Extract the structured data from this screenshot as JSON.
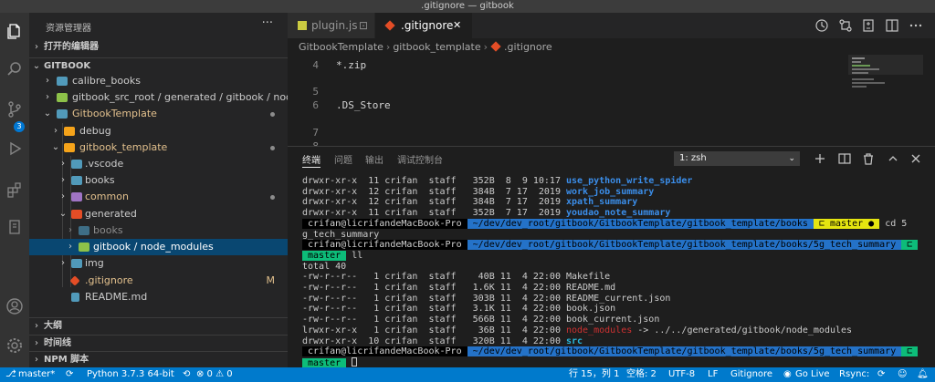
{
  "window": {
    "title": ".gitignore — gitbook"
  },
  "activity_bar": {
    "items": [
      "files-icon",
      "search-icon",
      "source-control-icon",
      "run-debug-icon",
      "extensions-icon",
      "notebook-icon",
      "account-icon",
      "settings-gear-icon"
    ],
    "scm_badge": "3"
  },
  "sidebar": {
    "title": "资源管理器",
    "more": "···",
    "open_editors": "打开的编辑器",
    "root": "GITBOOK",
    "tree": [
      {
        "label": "calibre_books"
      },
      {
        "label": "gitbook_src_root / generated / gitbook / node_..."
      },
      {
        "label": "GitbookTemplate"
      },
      {
        "label": "debug"
      },
      {
        "label": "gitbook_template"
      },
      {
        "label": ".vscode"
      },
      {
        "label": "books"
      },
      {
        "label": "common"
      },
      {
        "label": "generated"
      },
      {
        "label": "books"
      },
      {
        "label": "gitbook / node_modules"
      },
      {
        "label": "img"
      },
      {
        "label": ".gitignore",
        "badge": "M"
      },
      {
        "label": "README.md"
      }
    ],
    "outline": "大纲",
    "timeline": "时间线",
    "npm": "NPM 脚本"
  },
  "editor": {
    "tabs": [
      {
        "label": "plugin.js",
        "close": "⊡"
      },
      {
        "label": ".gitignore",
        "close": "✕"
      }
    ],
    "breadcrumb": [
      "GitbookTemplate",
      "gitbook_template",
      ".gitignore"
    ],
    "lines": [
      {
        "n": "4",
        "text": "*.zip"
      },
      {
        "n": "5",
        "text": ""
      },
      {
        "n": "6",
        "text": ".DS_Store"
      },
      {
        "n": "7",
        "text": ""
      },
      {
        "n": "8",
        "text": ""
      }
    ]
  },
  "panel": {
    "tabs": [
      "终端",
      "问题",
      "输出",
      "调试控制台"
    ],
    "terminal_select": "1: zsh",
    "terminal_lines": {
      "l1": {
        "perm": "drwxr-xr-x  11 crifan  staff   352B  8  9 10:17 ",
        "name": "use_python_write_spider"
      },
      "l2": {
        "perm": "drwxr-xr-x  12 crifan  staff   384B  7 17  2019 ",
        "name": "work_job_summary"
      },
      "l3": {
        "perm": "drwxr-xr-x  12 crifan  staff   384B  7 17  2019 ",
        "name": "xpath_summary"
      },
      "l4": {
        "perm": "drwxr-xr-x  11 crifan  staff   352B  7 17  2019 ",
        "name": "youdao_note_summary"
      },
      "p1": {
        "host": " crifan@licrifandeMacBook-Pro ",
        "path": " ~/dev/dev_root/gitbook/GitbookTemplate/gitbook_template/books ",
        "branch": " ⊏ master ● ",
        "cmd": " cd 5"
      },
      "p1_wrap": "g_tech_summary",
      "p2": {
        "host": " crifan@licrifandeMacBook-Pro ",
        "path": " ~/dev/dev_root/gitbook/GitbookTemplate/gitbook_template/books/5g_tech_summary ",
        "branch": " ⊏ ",
        "branch2": " master ",
        "cmd": " ll"
      },
      "total": "total 40",
      "files": [
        {
          "text": "-rw-r--r--   1 crifan  staff    40B 11  4 22:00 Makefile"
        },
        {
          "text": "-rw-r--r--   1 crifan  staff   1.6K 11  4 22:00 README.md"
        },
        {
          "text": "-rw-r--r--   1 crifan  staff   303B 11  4 22:00 README_current.json"
        },
        {
          "text": "-rw-r--r--   1 crifan  staff   3.1K 11  4 22:00 book.json"
        },
        {
          "text": "-rw-r--r--   1 crifan  staff   566B 11  4 22:00 book_current.json"
        }
      ],
      "link": {
        "perm": "lrwxr-xr-x   1 crifan  staff    36B 11  4 22:00 ",
        "name": "node_modules",
        "target": " -> ../../generated/gitbook/node_modules"
      },
      "src": {
        "perm": "drwxr-xr-x  10 crifan  staff   320B 11  4 22:00 ",
        "name": "src"
      },
      "p3": {
        "host": " crifan@licrifandeMacBook-Pro ",
        "path": " ~/dev/dev_root/gitbook/GitbookTemplate/gitbook_template/books/5g_tech_summary ",
        "branch": " ⊏ "
      },
      "p3_branch": " master "
    }
  },
  "status_bar": {
    "branch": "master*",
    "python": "Python 3.7.3 64-bit",
    "problems": "⊗ 0  ⚠ 0",
    "position": "行 15，列 1",
    "spaces": "空格: 2",
    "encoding": "UTF-8",
    "eol": "LF",
    "language": "Gitignore",
    "golive": "Go Live",
    "rsync": "Rsync:"
  },
  "colors": {
    "folder_blue": "#519aba",
    "folder_orange": "#f5a31a",
    "folder_purple": "#a074c4",
    "folder_green": "#8dc149",
    "folder_red": "#e44d26",
    "git_modified": "#e2c08d",
    "statusbar": "#007acc"
  }
}
